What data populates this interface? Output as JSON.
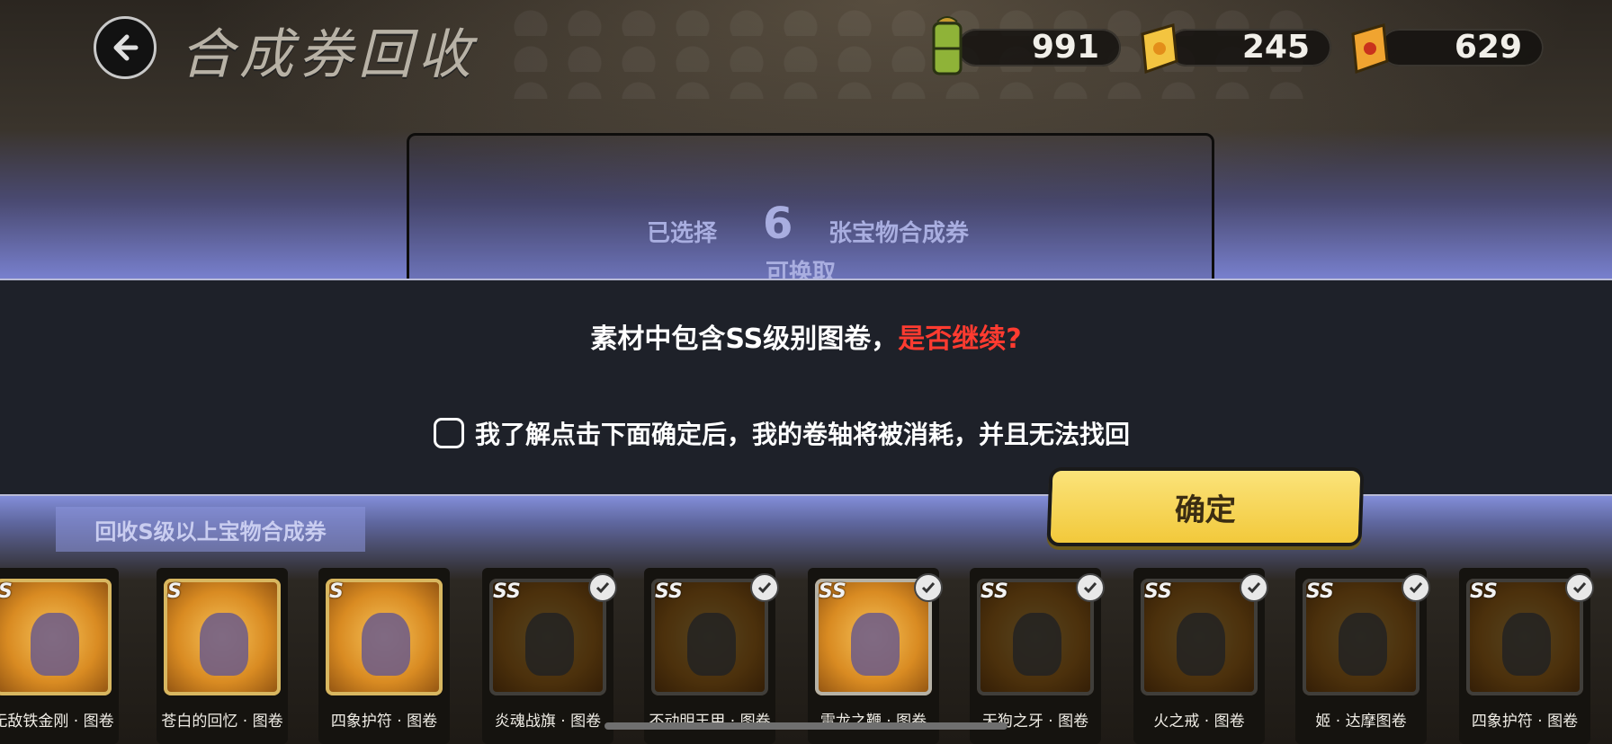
{
  "header": {
    "title": "合成券回收",
    "currencies": [
      {
        "icon": "bamboo-scroll-icon",
        "value": "991"
      },
      {
        "icon": "gold-ticket-icon",
        "value": "245"
      },
      {
        "icon": "red-gold-ticket-icon",
        "value": "629"
      }
    ]
  },
  "selection": {
    "prefix": "已选择",
    "count": "6",
    "suffix": "张宝物合成券",
    "sub": "可换取"
  },
  "dialog": {
    "message_main": "素材中包含SS级别图卷，",
    "message_warn": "是否继续?",
    "acknowledge": "我了解点击下面确定后，我的卷轴将被消耗，并且无法找回",
    "acknowledge_checked": false,
    "confirm_label": "确定"
  },
  "filter": {
    "label": "回收S级以上宝物合成券"
  },
  "cards": [
    {
      "grade": "S",
      "name": "无敌铁金刚 · 图卷",
      "selected": false
    },
    {
      "grade": "S",
      "name": "苍白的回忆 · 图卷",
      "selected": false
    },
    {
      "grade": "S",
      "name": "四象护符 · 图卷",
      "selected": false
    },
    {
      "grade": "SS",
      "name": "炎魂战旗 · 图卷",
      "selected": true
    },
    {
      "grade": "SS",
      "name": "不动明王甲 · 图卷",
      "selected": true
    },
    {
      "grade": "SS",
      "name": "雷龙之鞭 · 图卷",
      "selected": true
    },
    {
      "grade": "SS",
      "name": "天狗之牙 · 图卷",
      "selected": true
    },
    {
      "grade": "SS",
      "name": "火之戒 · 图卷",
      "selected": true
    },
    {
      "grade": "SS",
      "name": "姬 · 达摩图卷",
      "selected": true
    },
    {
      "grade": "SS",
      "name": "四象护符 · 图卷",
      "selected": true
    }
  ]
}
